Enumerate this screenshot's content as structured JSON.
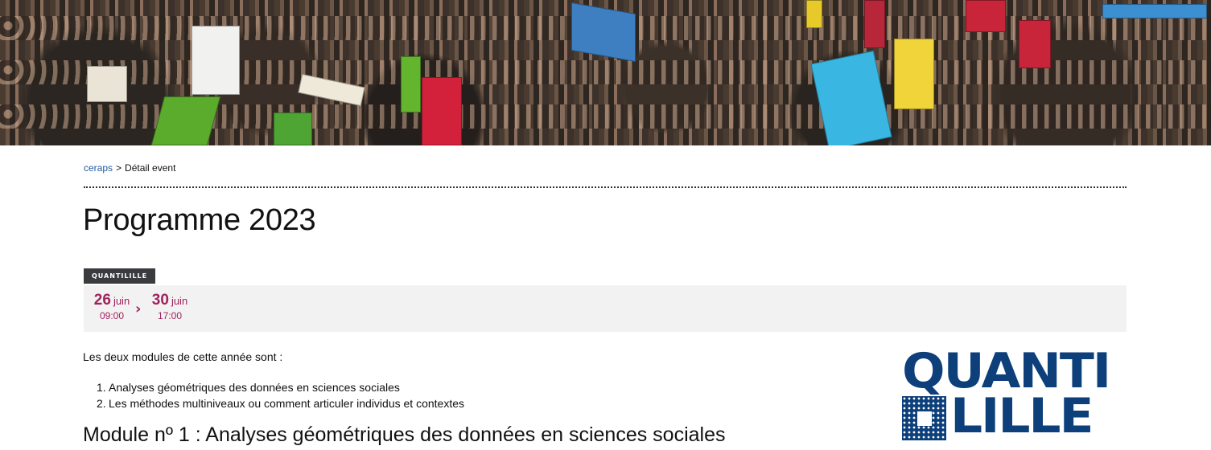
{
  "breadcrumb": {
    "root_label": "ceraps",
    "separator": ">",
    "current_label": "Détail event"
  },
  "page": {
    "title": "Programme 2023"
  },
  "event": {
    "tag": "QUANTILILLE",
    "start": {
      "day": "26",
      "month": "juin",
      "time": "09:00"
    },
    "arrow": "›",
    "end": {
      "day": "30",
      "month": "juin",
      "time": "17:00"
    }
  },
  "content": {
    "intro": "Les deux modules de cette année sont :",
    "modules": [
      {
        "num": "1.",
        "label": "Analyses géométriques des données en sciences sociales"
      },
      {
        "num": "2.",
        "label": "Les méthodes multiniveaux ou comment articuler individus et contextes"
      }
    ],
    "section_title": "Module nº 1 : Analyses géométriques des données en sciences sociales"
  },
  "logo": {
    "line1": "QUANTI",
    "line2": "LILLE"
  },
  "colors": {
    "accent": "#a0235f",
    "link": "#1f5c9e",
    "tag_bg": "#3a3b3f",
    "date_bg": "#f2f2f2",
    "logo": "#0d3f7a"
  }
}
